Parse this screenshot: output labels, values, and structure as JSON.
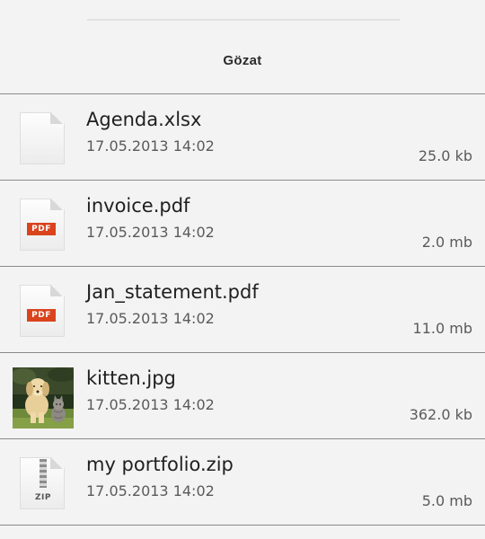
{
  "header": {
    "title": "Gözat"
  },
  "files": [
    {
      "name": "Agenda.xlsx",
      "date": "17.05.2013 14:02",
      "size": "25.0 kb",
      "icon": "document-icon"
    },
    {
      "name": "invoice.pdf",
      "date": "17.05.2013 14:02",
      "size": "2.0 mb",
      "icon": "pdf-icon",
      "badge": "PDF"
    },
    {
      "name": "Jan_statement.pdf",
      "date": "17.05.2013 14:02",
      "size": "11.0 mb",
      "icon": "pdf-icon",
      "badge": "PDF"
    },
    {
      "name": "kitten.jpg",
      "date": "17.05.2013 14:02",
      "size": "362.0 kb",
      "icon": "image-thumbnail"
    },
    {
      "name": "my portfolio.zip",
      "date": "17.05.2013 14:02",
      "size": "5.0 mb",
      "icon": "zip-icon",
      "badge": "ZIP"
    }
  ]
}
